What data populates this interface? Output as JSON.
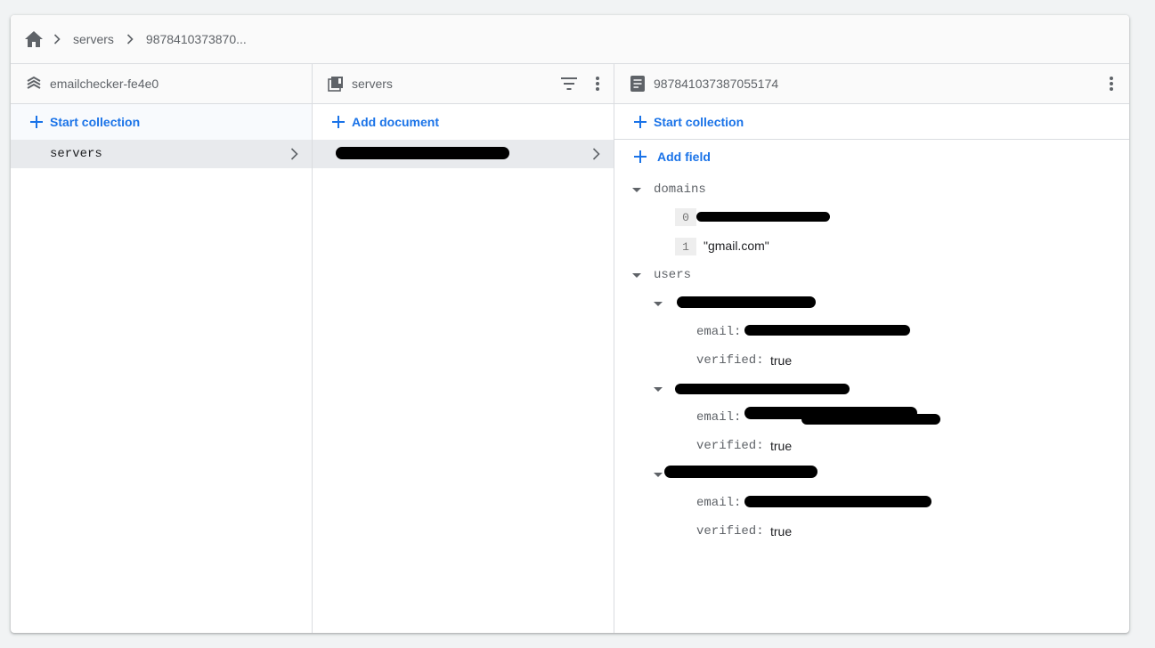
{
  "breadcrumb": {
    "items": [
      "servers",
      "9878410373870..."
    ]
  },
  "columns": {
    "project": {
      "title": "emailchecker-fe4e0",
      "action_label": "Start collection",
      "items": [
        {
          "label": "servers"
        }
      ]
    },
    "collection": {
      "title": "servers",
      "action_label": "Add document"
    },
    "document": {
      "title": "987841037387055174",
      "start_collection_label": "Start collection",
      "add_field_label": "Add field",
      "fields": {
        "domains": {
          "name": "domains",
          "items": [
            {
              "index": "0"
            },
            {
              "index": "1",
              "value": "\"gmail.com\""
            }
          ]
        },
        "users": {
          "name": "users",
          "entries": [
            {
              "email_key": "email:",
              "verified_key": "verified:",
              "verified_value": "true"
            },
            {
              "email_key": "email:",
              "verified_key": "verified:",
              "verified_value": "true"
            },
            {
              "email_key": "email:",
              "verified_key": "verified:",
              "verified_value": "true"
            }
          ]
        }
      }
    }
  },
  "colors": {
    "accent": "#1a73e8",
    "selected_row": "#e8eaed",
    "border": "#dadce0"
  }
}
